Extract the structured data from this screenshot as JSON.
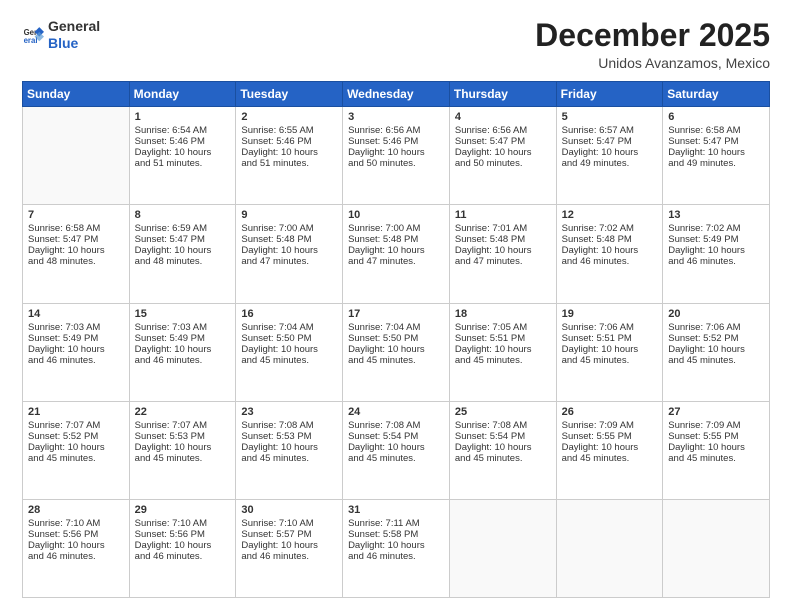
{
  "header": {
    "logo_general": "General",
    "logo_blue": "Blue",
    "month_title": "December 2025",
    "location": "Unidos Avanzamos, Mexico"
  },
  "days_of_week": [
    "Sunday",
    "Monday",
    "Tuesday",
    "Wednesday",
    "Thursday",
    "Friday",
    "Saturday"
  ],
  "weeks": [
    [
      {
        "day": "",
        "info": ""
      },
      {
        "day": "1",
        "info": "Sunrise: 6:54 AM\nSunset: 5:46 PM\nDaylight: 10 hours\nand 51 minutes."
      },
      {
        "day": "2",
        "info": "Sunrise: 6:55 AM\nSunset: 5:46 PM\nDaylight: 10 hours\nand 51 minutes."
      },
      {
        "day": "3",
        "info": "Sunrise: 6:56 AM\nSunset: 5:46 PM\nDaylight: 10 hours\nand 50 minutes."
      },
      {
        "day": "4",
        "info": "Sunrise: 6:56 AM\nSunset: 5:47 PM\nDaylight: 10 hours\nand 50 minutes."
      },
      {
        "day": "5",
        "info": "Sunrise: 6:57 AM\nSunset: 5:47 PM\nDaylight: 10 hours\nand 49 minutes."
      },
      {
        "day": "6",
        "info": "Sunrise: 6:58 AM\nSunset: 5:47 PM\nDaylight: 10 hours\nand 49 minutes."
      }
    ],
    [
      {
        "day": "7",
        "info": "Sunrise: 6:58 AM\nSunset: 5:47 PM\nDaylight: 10 hours\nand 48 minutes."
      },
      {
        "day": "8",
        "info": "Sunrise: 6:59 AM\nSunset: 5:47 PM\nDaylight: 10 hours\nand 48 minutes."
      },
      {
        "day": "9",
        "info": "Sunrise: 7:00 AM\nSunset: 5:48 PM\nDaylight: 10 hours\nand 47 minutes."
      },
      {
        "day": "10",
        "info": "Sunrise: 7:00 AM\nSunset: 5:48 PM\nDaylight: 10 hours\nand 47 minutes."
      },
      {
        "day": "11",
        "info": "Sunrise: 7:01 AM\nSunset: 5:48 PM\nDaylight: 10 hours\nand 47 minutes."
      },
      {
        "day": "12",
        "info": "Sunrise: 7:02 AM\nSunset: 5:48 PM\nDaylight: 10 hours\nand 46 minutes."
      },
      {
        "day": "13",
        "info": "Sunrise: 7:02 AM\nSunset: 5:49 PM\nDaylight: 10 hours\nand 46 minutes."
      }
    ],
    [
      {
        "day": "14",
        "info": "Sunrise: 7:03 AM\nSunset: 5:49 PM\nDaylight: 10 hours\nand 46 minutes."
      },
      {
        "day": "15",
        "info": "Sunrise: 7:03 AM\nSunset: 5:49 PM\nDaylight: 10 hours\nand 46 minutes."
      },
      {
        "day": "16",
        "info": "Sunrise: 7:04 AM\nSunset: 5:50 PM\nDaylight: 10 hours\nand 45 minutes."
      },
      {
        "day": "17",
        "info": "Sunrise: 7:04 AM\nSunset: 5:50 PM\nDaylight: 10 hours\nand 45 minutes."
      },
      {
        "day": "18",
        "info": "Sunrise: 7:05 AM\nSunset: 5:51 PM\nDaylight: 10 hours\nand 45 minutes."
      },
      {
        "day": "19",
        "info": "Sunrise: 7:06 AM\nSunset: 5:51 PM\nDaylight: 10 hours\nand 45 minutes."
      },
      {
        "day": "20",
        "info": "Sunrise: 7:06 AM\nSunset: 5:52 PM\nDaylight: 10 hours\nand 45 minutes."
      }
    ],
    [
      {
        "day": "21",
        "info": "Sunrise: 7:07 AM\nSunset: 5:52 PM\nDaylight: 10 hours\nand 45 minutes."
      },
      {
        "day": "22",
        "info": "Sunrise: 7:07 AM\nSunset: 5:53 PM\nDaylight: 10 hours\nand 45 minutes."
      },
      {
        "day": "23",
        "info": "Sunrise: 7:08 AM\nSunset: 5:53 PM\nDaylight: 10 hours\nand 45 minutes."
      },
      {
        "day": "24",
        "info": "Sunrise: 7:08 AM\nSunset: 5:54 PM\nDaylight: 10 hours\nand 45 minutes."
      },
      {
        "day": "25",
        "info": "Sunrise: 7:08 AM\nSunset: 5:54 PM\nDaylight: 10 hours\nand 45 minutes."
      },
      {
        "day": "26",
        "info": "Sunrise: 7:09 AM\nSunset: 5:55 PM\nDaylight: 10 hours\nand 45 minutes."
      },
      {
        "day": "27",
        "info": "Sunrise: 7:09 AM\nSunset: 5:55 PM\nDaylight: 10 hours\nand 45 minutes."
      }
    ],
    [
      {
        "day": "28",
        "info": "Sunrise: 7:10 AM\nSunset: 5:56 PM\nDaylight: 10 hours\nand 46 minutes."
      },
      {
        "day": "29",
        "info": "Sunrise: 7:10 AM\nSunset: 5:56 PM\nDaylight: 10 hours\nand 46 minutes."
      },
      {
        "day": "30",
        "info": "Sunrise: 7:10 AM\nSunset: 5:57 PM\nDaylight: 10 hours\nand 46 minutes."
      },
      {
        "day": "31",
        "info": "Sunrise: 7:11 AM\nSunset: 5:58 PM\nDaylight: 10 hours\nand 46 minutes."
      },
      {
        "day": "",
        "info": ""
      },
      {
        "day": "",
        "info": ""
      },
      {
        "day": "",
        "info": ""
      }
    ]
  ]
}
